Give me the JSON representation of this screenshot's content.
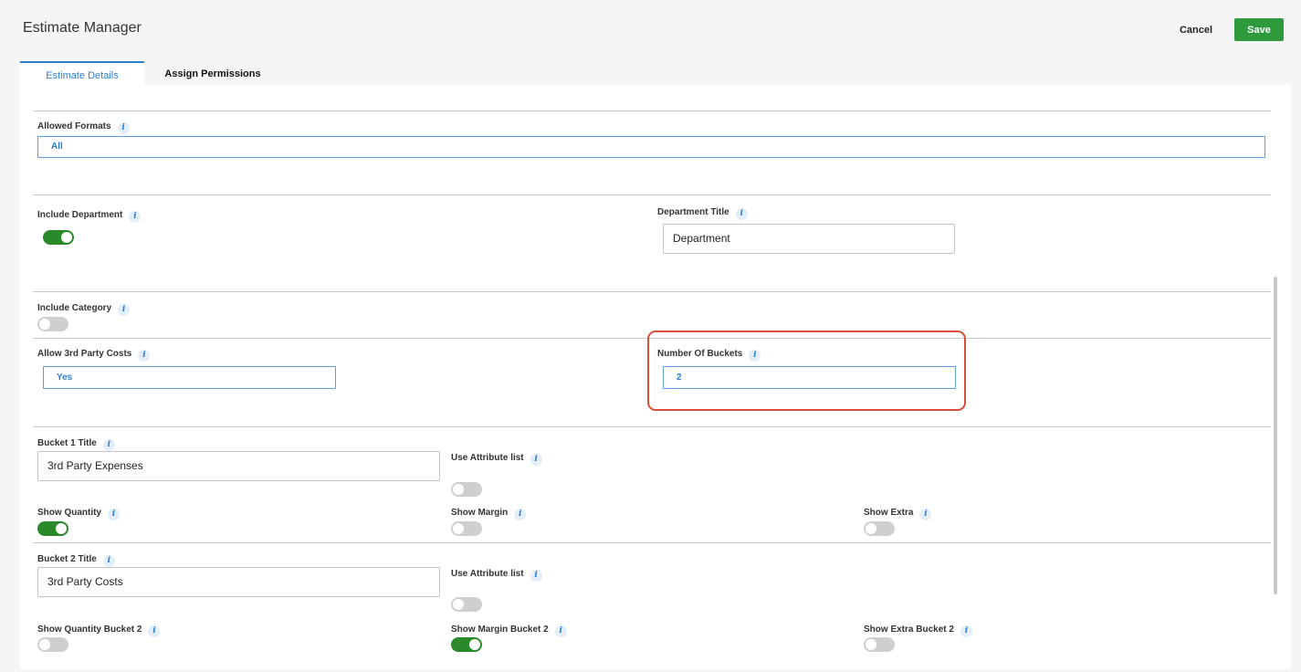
{
  "header": {
    "title": "Estimate Manager",
    "cancel_label": "Cancel",
    "save_label": "Save"
  },
  "tabs": [
    {
      "label": "Estimate Details",
      "active": true
    },
    {
      "label": "Assign Permissions",
      "active": false
    }
  ],
  "info_glyph": "i",
  "form": {
    "allowed_formats": {
      "label": "Allowed Formats",
      "value": "All"
    },
    "include_department": {
      "label": "Include Department",
      "on": true
    },
    "department_title": {
      "label": "Department Title",
      "value": "Department"
    },
    "include_category": {
      "label": "Include Category",
      "on": false
    },
    "allow_3rd_party_costs": {
      "label": "Allow 3rd Party Costs",
      "value": "Yes"
    },
    "number_of_buckets": {
      "label": "Number Of Buckets",
      "value": "2"
    },
    "bucket1": {
      "title_label": "Bucket 1 Title",
      "title_value": "3rd Party Expenses",
      "use_attribute_list": {
        "label": "Use Attribute list",
        "on": false
      },
      "show_quantity": {
        "label": "Show Quantity",
        "on": true
      },
      "show_margin": {
        "label": "Show Margin",
        "on": false
      },
      "show_extra": {
        "label": "Show Extra",
        "on": false
      }
    },
    "bucket2": {
      "title_label": "Bucket 2 Title",
      "title_value": "3rd Party Costs",
      "use_attribute_list": {
        "label": "Use Attribute list",
        "on": false
      },
      "show_quantity": {
        "label": "Show Quantity Bucket 2",
        "on": false
      },
      "show_margin": {
        "label": "Show Margin Bucket 2",
        "on": true
      },
      "show_extra": {
        "label": "Show Extra Bucket 2",
        "on": false
      }
    }
  },
  "colors": {
    "accent": "#2f7fd1",
    "save_green": "#2e9a3c",
    "toggle_on": "#2a8a2a",
    "highlight": "#d8503b"
  }
}
